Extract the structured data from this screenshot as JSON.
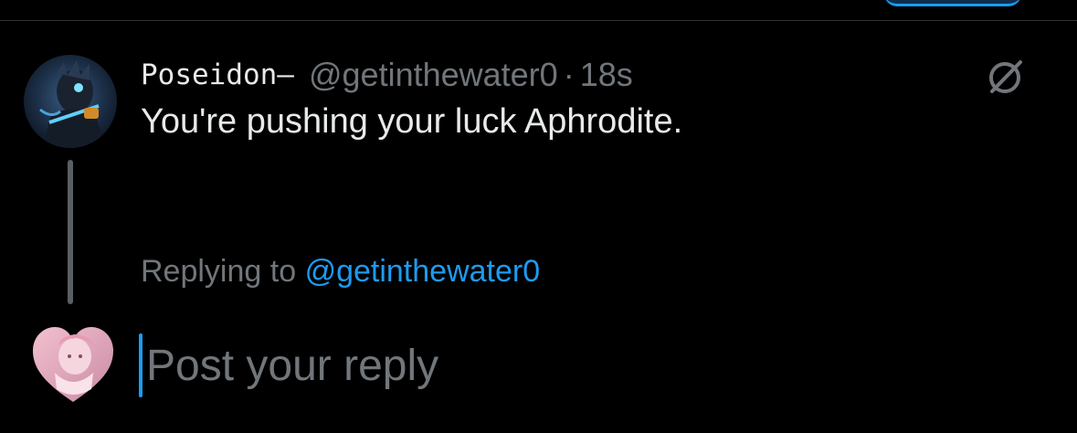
{
  "post": {
    "display_name": "Poseidon—",
    "handle": "@getinthewater0",
    "separator": "·",
    "time": "18s",
    "text": "You're pushing your luck Aphrodite.",
    "author_avatar": "poseidon-avatar"
  },
  "reply": {
    "replying_prefix": "Replying to",
    "replying_handle": "@getinthewater0",
    "placeholder": "Post your reply",
    "user_avatar": "aphrodite-heart-avatar"
  },
  "icons": {
    "grok": "grok-icon"
  },
  "colors": {
    "background": "#000000",
    "text_primary": "#e7e9ea",
    "text_secondary": "#71767b",
    "accent": "#1d9bf0",
    "thread_line": "#5b5f63"
  }
}
